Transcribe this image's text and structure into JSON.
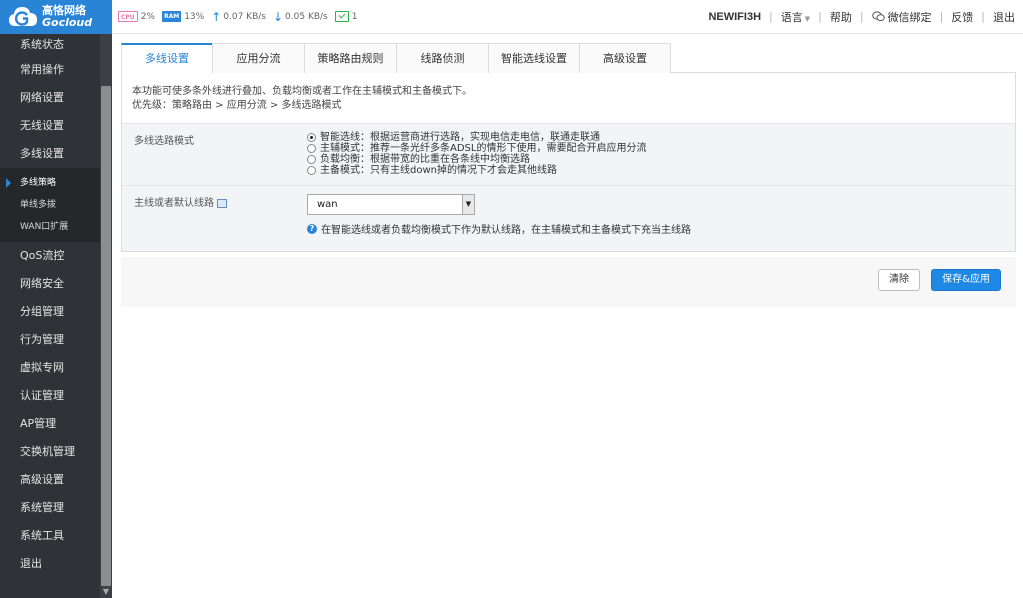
{
  "logo": {
    "cn": "高恪网络",
    "en": "Gocloud"
  },
  "topbar": {
    "cpu_chip": "CPU",
    "cpu_value": "2%",
    "ram_chip": "RAM",
    "ram_value": "13%",
    "upload": "0.07 KB/s",
    "download": "0.05 KB/s",
    "terminals": "1",
    "device": "NEWIFI3H",
    "language": "语言",
    "help": "帮助",
    "wechat": "微信绑定",
    "feedback": "反馈",
    "logout": "退出"
  },
  "sidebar": {
    "items_top": [
      "系统状态",
      "常用操作",
      "网络设置",
      "无线设置",
      "多线设置"
    ],
    "subitems": [
      "多线策略",
      "单线多拨",
      "WAN口扩展"
    ],
    "items_bottom": [
      "QoS流控",
      "网络安全",
      "分组管理",
      "行为管理",
      "虚拟专网",
      "认证管理",
      "AP管理",
      "交换机管理",
      "高级设置",
      "系统管理",
      "系统工具",
      "退出"
    ]
  },
  "tabs": [
    "多线设置",
    "应用分流",
    "策略路由规则",
    "线路侦测",
    "智能选线设置",
    "高级设置"
  ],
  "description": {
    "line1": "本功能可使多条外线进行叠加、负载均衡或者工作在主辅模式和主备模式下。",
    "line2": "优先级：策略路由 > 应用分流 > 多线选路模式"
  },
  "mode": {
    "label": "多线选路模式",
    "options": [
      "智能选线：根据运营商进行选路，实现电信走电信，联通走联通",
      "主辅模式：推荐一条光纤多条ADSL的情形下使用，需要配合开启应用分流",
      "负载均衡：根据带宽的比重在各条线中均衡选路",
      "主备模式：只有主线down掉的情况下才会走其他线路"
    ],
    "selected_index": 0
  },
  "default_line": {
    "label": "主线或者默认线路",
    "value": "wan",
    "help": "在智能选线或者负载均衡模式下作为默认线路，在主辅模式和主备模式下充当主线路"
  },
  "buttons": {
    "clear": "清除",
    "save": "保存&应用"
  }
}
